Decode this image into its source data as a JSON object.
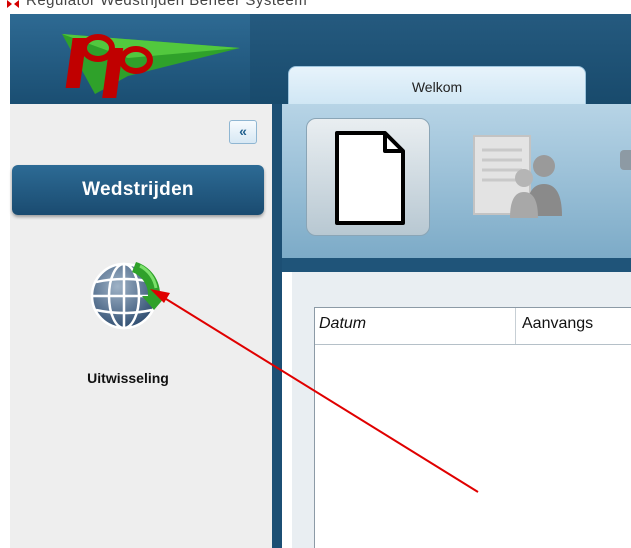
{
  "window": {
    "title": "Regulator Wedstrijden Beheer Systeem"
  },
  "tabs": [
    {
      "label": "Welkom",
      "active": true
    }
  ],
  "sidebar": {
    "collapse_label": "«",
    "section_button": "Wedstrijden",
    "items": [
      {
        "label": "Uitwisseling",
        "icon": "globe-sync-icon"
      }
    ]
  },
  "toolbar": {
    "buttons": [
      {
        "icon": "new-document-icon",
        "selected": true
      },
      {
        "icon": "persons-document-icon",
        "selected": false
      }
    ]
  },
  "grid": {
    "columns": [
      "Datum",
      "Aanvangs"
    ]
  },
  "colors": {
    "header_blue": "#1f5479",
    "accent_green": "#2fa12a",
    "arrow_red": "#e00000"
  }
}
